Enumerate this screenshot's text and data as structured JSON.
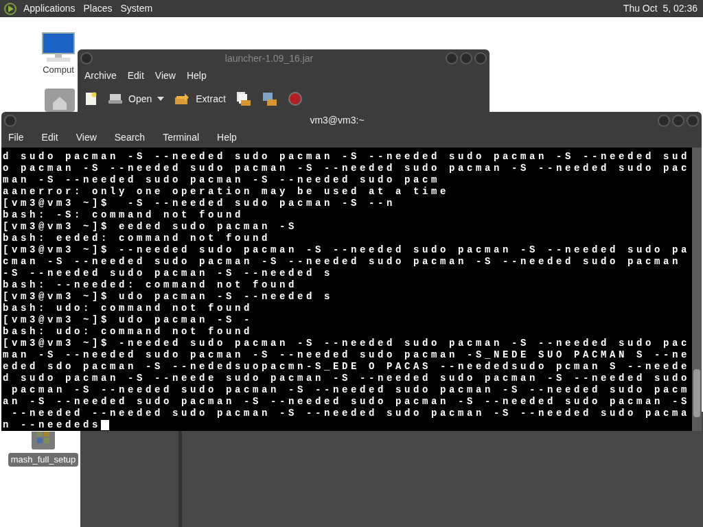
{
  "top_panel": {
    "menus": [
      "Applications",
      "Places",
      "System"
    ],
    "clock": "Thu Oct  5, 02:36"
  },
  "desktop_icons": [
    {
      "kind": "computer",
      "label": "Comput"
    },
    {
      "kind": "home"
    },
    {
      "kind": "installer",
      "label": "mash_full_setup"
    }
  ],
  "archive_window": {
    "title": "launcher-1.09_16.jar",
    "menus": [
      "Archive",
      "Edit",
      "View",
      "Help"
    ],
    "toolbar": [
      {
        "kind": "new"
      },
      {
        "kind": "open",
        "label": "Open"
      },
      {
        "kind": "extract",
        "label": "Extract"
      },
      {
        "kind": "add-files"
      },
      {
        "kind": "add-folder"
      },
      {
        "kind": "stop"
      }
    ]
  },
  "terminal_window": {
    "title": "vm3@vm3:~",
    "menus": [
      "File",
      "Edit",
      "View",
      "Search",
      "Terminal",
      "Help"
    ],
    "lines": [
      "d sudo pacman -S --needed sudo pacman -S --needed sudo pacman -S --needed sud",
      "o pacman -S --needed sudo pacman -S --needed sudo pacman -S --needed sudo pac",
      "man -S --needed sudo pacman -S --needed sudo pacm",
      "aanerror: only one operation may be used at a time",
      "[vm3@vm3 ~]$  -S --needed sudo pacman -S --n",
      "bash: -S: command not found",
      "[vm3@vm3 ~]$ eeded sudo pacman -S",
      "bash: eeded: command not found",
      "[vm3@vm3 ~]$ --needed sudo pacman -S --needed sudo pacman -S --needed sudo pa",
      "cman -S --needed sudo pacman -S --needed sudo pacman -S --needed sudo pacman",
      "-S --needed sudo pacman -S --needed s",
      "bash: --needed: command not found",
      "[vm3@vm3 ~]$ udo pacman -S --needed s",
      "bash: udo: command not found",
      "[vm3@vm3 ~]$ udo pacman -S -",
      "bash: udo: command not found",
      "[vm3@vm3 ~]$ -needed sudo pacman -S --needed sudo pacman -S --needed sudo pac",
      "man -S --needed sudo pacman -S --needed sudo pacman -S_NEDE SUO PACMAN S --ne",
      "eded sdo pacman -S --nededsuopacmn-S_EDE O PACAS --neededsudo pcman S --neede",
      "d sudo pacman -S --neede sudo pacman -S --needed sudo pacman -S --needed sudo",
      " pacman -S --needed sudo pacman -S --needed sudo pacman -S --needed sudo pacm",
      "an -S --needed sudo pacman -S --needed sudo pacman -S --needed sudo pacman -S",
      " --needed --needed sudo pacman -S --needed sudo pacman -S --needed sudo pacma",
      "n --neededs"
    ]
  }
}
